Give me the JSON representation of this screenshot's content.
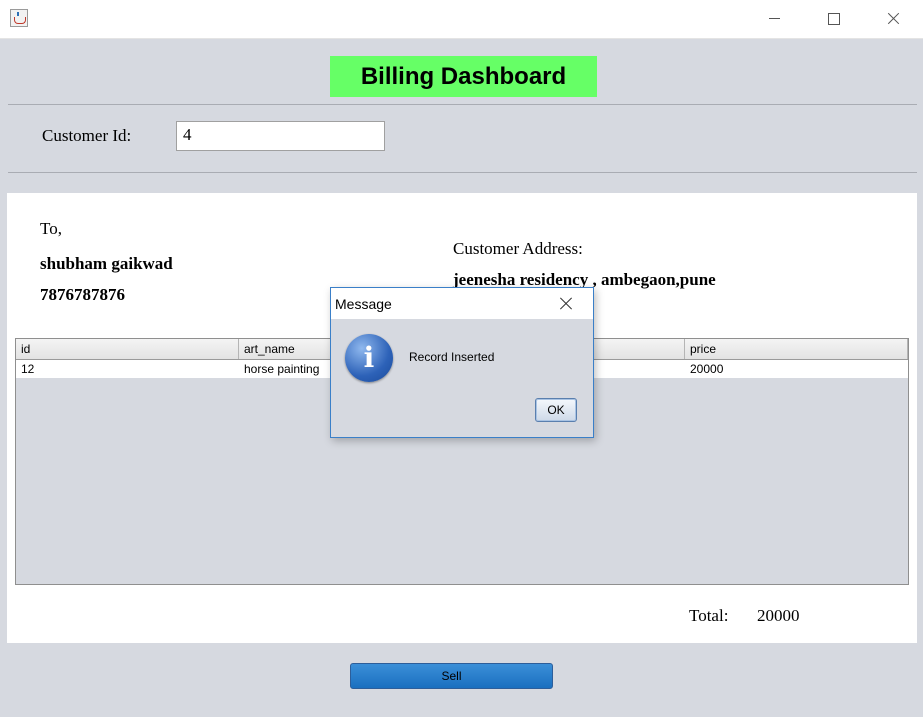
{
  "window": {
    "icon": "java-cup-icon"
  },
  "header": {
    "title": "Billing Dashboard",
    "accent": "#66ff66"
  },
  "customer": {
    "id_label": "Customer Id:",
    "id_value": "4"
  },
  "bill": {
    "to_label": "To,",
    "name": "shubham gaikwad",
    "phone": "7876787876",
    "address_label": "Customer Address:",
    "address": "jeenesha residency , ambegaon,pune"
  },
  "table": {
    "columns": [
      "id",
      "art_name",
      "",
      "price"
    ],
    "rows": [
      [
        "12",
        "horse painting",
        "",
        "20000"
      ]
    ]
  },
  "total": {
    "label": "Total:",
    "value": "20000"
  },
  "sell_button": "Sell",
  "dialog": {
    "title": "Message",
    "icon": "info-icon",
    "message": "Record Inserted",
    "ok": "OK"
  }
}
